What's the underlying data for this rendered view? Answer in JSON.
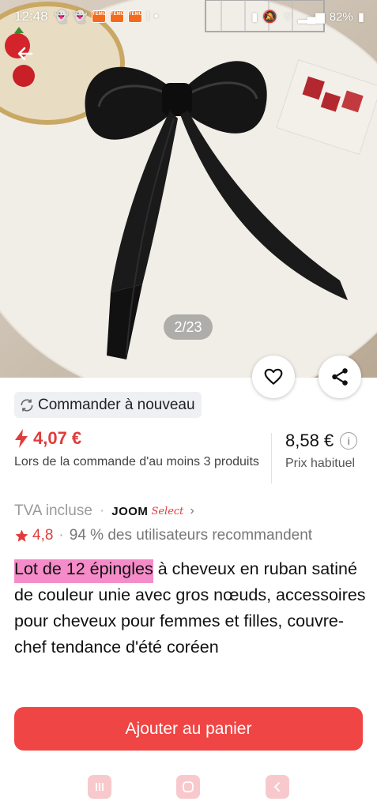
{
  "status_bar": {
    "time": "12:48",
    "battery": "82%",
    "app_badge_text": "TEMU"
  },
  "gallery": {
    "counter": "2/23"
  },
  "reorder": {
    "label": "Commander à nouveau"
  },
  "price": {
    "promo": "4,07 €",
    "promo_condition": "Lors de la commande d'au moins 3 produits",
    "regular": "8,58 €",
    "regular_label": "Prix habituel"
  },
  "vat": {
    "label": "TVA incluse",
    "brand": "JOOM",
    "brand_suffix": "Select"
  },
  "rating": {
    "value": "4,8",
    "recommend": "94 % des utilisateurs recommandent"
  },
  "product": {
    "title_highlight": "Lot de 12 épingles",
    "title_rest": " à cheveux en ruban satiné de couleur unie avec gros nœuds, accessoires pour cheveux pour femmes et filles, couvre-chef tendance d'été coréen"
  },
  "cta": {
    "label": "Ajouter au panier"
  },
  "colors": {
    "accent": "#f04545",
    "price_red": "#e23b3b",
    "highlight": "#f58cc9"
  },
  "icons": [
    "back-arrow-icon",
    "heart-icon",
    "share-icon",
    "refresh-icon",
    "lightning-icon",
    "info-icon",
    "star-icon",
    "chevron-right-icon",
    "recent-apps-icon",
    "home-icon",
    "nav-back-icon"
  ]
}
